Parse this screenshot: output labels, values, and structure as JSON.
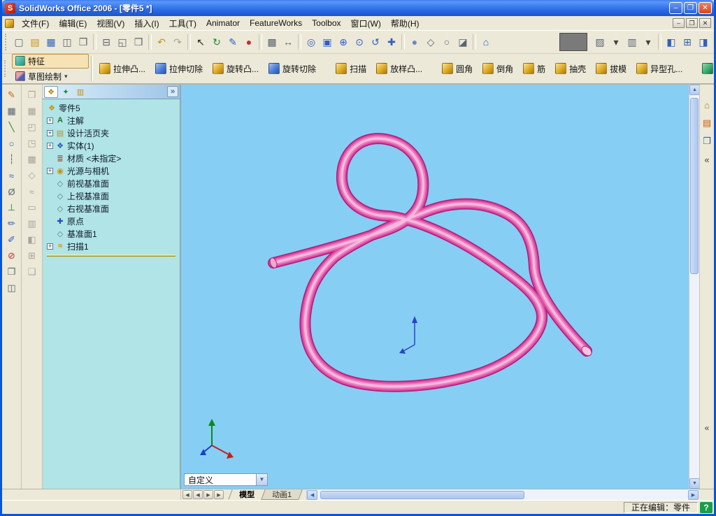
{
  "colors": {
    "titlebar_blue": "#2F6FE8",
    "toolbar_bg": "#ECE9D8",
    "tree_panel_cyan": "#B0E4E6",
    "viewport_blue": "#86CEF4",
    "knot_dark": "#B21E7C",
    "knot_main": "#DD4FA4",
    "knot_light": "#F7B9DE",
    "rollback_yellow": "#E8D020",
    "help_green": "#18A048",
    "active_tab_tan": "#F6E2B4"
  },
  "window": {
    "title": "SolidWorks Office 2006 - [零件5 *]",
    "minimize_glyph": "–",
    "restore_glyph": "❐",
    "close_glyph": "✕"
  },
  "menu": {
    "items": [
      {
        "label": "文件(F)",
        "name": "menu-file"
      },
      {
        "label": "编辑(E)",
        "name": "menu-edit"
      },
      {
        "label": "视图(V)",
        "name": "menu-view"
      },
      {
        "label": "插入(I)",
        "name": "menu-insert"
      },
      {
        "label": "工具(T)",
        "name": "menu-tools"
      },
      {
        "label": "Animator",
        "name": "menu-animator"
      },
      {
        "label": "FeatureWorks",
        "name": "menu-featureworks"
      },
      {
        "label": "Toolbox",
        "name": "menu-toolbox"
      },
      {
        "label": "窗口(W)",
        "name": "menu-window"
      },
      {
        "label": "帮助(H)",
        "name": "menu-help"
      }
    ],
    "mdi": {
      "minimize": "–",
      "restore": "❐",
      "close": "✕"
    }
  },
  "toolbar_main": {
    "icons": [
      {
        "name": "new-document-icon",
        "glyph": "▢",
        "cls": "c-gray",
        "inter": "true"
      },
      {
        "name": "open-document-icon",
        "glyph": "▤",
        "cls": "c-yellow",
        "inter": "true"
      },
      {
        "name": "save-icon",
        "glyph": "▦",
        "cls": "c-blue",
        "inter": "true"
      },
      {
        "name": "make-drawing-icon",
        "glyph": "◫",
        "cls": "c-gray",
        "inter": "true"
      },
      {
        "name": "make-assembly-icon",
        "glyph": "❒",
        "cls": "c-gray",
        "inter": "true"
      },
      {
        "name": "separator",
        "glyph": "",
        "cls": "sep",
        "inter": "false"
      },
      {
        "name": "print-icon",
        "glyph": "⊟",
        "cls": "c-gray",
        "inter": "true"
      },
      {
        "name": "print-preview-icon",
        "glyph": "◱",
        "cls": "c-gray",
        "inter": "true"
      },
      {
        "name": "copy-icon",
        "glyph": "❐",
        "cls": "c-gray",
        "inter": "true"
      },
      {
        "name": "separator",
        "glyph": "",
        "cls": "sep",
        "inter": "false"
      },
      {
        "name": "undo-icon",
        "glyph": "↶",
        "cls": "c-yellow",
        "inter": "true"
      },
      {
        "name": "redo-icon",
        "glyph": "↷",
        "cls": "c-dis",
        "inter": "true"
      },
      {
        "name": "separator",
        "glyph": "",
        "cls": "sep",
        "inter": "false"
      },
      {
        "name": "select-arrow-icon",
        "glyph": "↖",
        "cls": "c-black",
        "inter": "true"
      },
      {
        "name": "rebuild-icon",
        "glyph": "↻",
        "cls": "c-green",
        "inter": "true"
      },
      {
        "name": "sketch-icon",
        "glyph": "✎",
        "cls": "c-blue",
        "inter": "true"
      },
      {
        "name": "edit-color-icon",
        "glyph": "●",
        "cls": "c-red",
        "inter": "true"
      },
      {
        "name": "separator",
        "glyph": "",
        "cls": "sep",
        "inter": "false"
      },
      {
        "name": "display-grid-icon",
        "glyph": "▩",
        "cls": "c-gray",
        "inter": "true"
      },
      {
        "name": "dimension-icon",
        "glyph": "↔",
        "cls": "c-gray",
        "inter": "true"
      },
      {
        "name": "separator",
        "glyph": "",
        "cls": "sep",
        "inter": "false"
      },
      {
        "name": "zoom-fit-icon",
        "glyph": "◎",
        "cls": "c-blue",
        "inter": "true"
      },
      {
        "name": "zoom-area-icon",
        "glyph": "▣",
        "cls": "c-blue",
        "inter": "true"
      },
      {
        "name": "zoom-in-out-icon",
        "glyph": "⊕",
        "cls": "c-blue",
        "inter": "true"
      },
      {
        "name": "zoom-selected-icon",
        "glyph": "⊙",
        "cls": "c-blue",
        "inter": "true"
      },
      {
        "name": "rotate-view-icon",
        "glyph": "↺",
        "cls": "c-blue",
        "inter": "true"
      },
      {
        "name": "pan-icon",
        "glyph": "✚",
        "cls": "c-blue",
        "inter": "true"
      },
      {
        "name": "separator",
        "glyph": "",
        "cls": "sep",
        "inter": "false"
      },
      {
        "name": "shaded-view-icon",
        "glyph": "●",
        "cls": "c-shaded",
        "inter": "true"
      },
      {
        "name": "hidden-lines-icon",
        "glyph": "◇",
        "cls": "c-gray",
        "inter": "true"
      },
      {
        "name": "wireframe-icon",
        "glyph": "○",
        "cls": "c-gray",
        "inter": "true"
      },
      {
        "name": "section-view-icon",
        "glyph": "◪",
        "cls": "c-gray",
        "inter": "true"
      },
      {
        "name": "separator",
        "glyph": "",
        "cls": "sep",
        "inter": "false"
      },
      {
        "name": "view-orientation-icon",
        "glyph": "⌂",
        "cls": "c-blue",
        "inter": "true"
      }
    ],
    "right_icons": [
      {
        "name": "toolbox-panel-icon",
        "glyph": "▨",
        "cls": "c-gray",
        "inter": "true"
      },
      {
        "name": "dropdown-arrow-icon",
        "glyph": "▾",
        "cls": "c-dark",
        "inter": "true"
      },
      {
        "name": "options-icon",
        "glyph": "▥",
        "cls": "c-gray",
        "inter": "true"
      },
      {
        "name": "dropdown-arrow-icon",
        "glyph": "▾",
        "cls": "c-dark",
        "inter": "true"
      },
      {
        "name": "separator",
        "glyph": "",
        "cls": "sep",
        "inter": "false"
      },
      {
        "name": "pane-left-icon",
        "glyph": "◧",
        "cls": "c-blue",
        "inter": "true"
      },
      {
        "name": "pane-split-icon",
        "glyph": "⊞",
        "cls": "c-blue",
        "inter": "true"
      },
      {
        "name": "pane-right-icon",
        "glyph": "◨",
        "cls": "c-blue",
        "inter": "true"
      }
    ]
  },
  "command_manager": {
    "tabs": [
      {
        "label": "特征",
        "name": "tab-features",
        "icon": "features-tab-icon",
        "iconcls": "fi-teal",
        "cls": "act",
        "arrow": ""
      },
      {
        "label": "草图绘制",
        "name": "tab-sketch",
        "icon": "sketch-tab-icon",
        "iconcls": "fi-sketch",
        "cls": "",
        "arrow": "▾"
      }
    ],
    "buttons": [
      {
        "label": "拉伸凸...",
        "name": "extrude-boss-button",
        "icon": "extrude-boss-icon",
        "cls": "fi-gold",
        "btncls": ""
      },
      {
        "label": "拉伸切除",
        "name": "extruded-cut-button",
        "icon": "extruded-cut-icon",
        "cls": "fi-blue",
        "btncls": ""
      },
      {
        "label": "旋转凸...",
        "name": "revolve-boss-button",
        "icon": "revolve-boss-icon",
        "cls": "fi-gold",
        "btncls": ""
      },
      {
        "label": "旋转切除",
        "name": "revolved-cut-button",
        "icon": "revolved-cut-icon",
        "cls": "fi-blue",
        "btncls": ""
      },
      {
        "label": "扫描",
        "name": "sweep-button",
        "icon": "sweep-icon",
        "cls": "fi-gold",
        "btncls": "gapL"
      },
      {
        "label": "放样凸...",
        "name": "loft-button",
        "icon": "loft-icon",
        "cls": "fi-gold",
        "btncls": ""
      },
      {
        "label": "圆角",
        "name": "fillet-button",
        "icon": "fillet-icon",
        "cls": "fi-gold",
        "btncls": "gapL"
      },
      {
        "label": "倒角",
        "name": "chamfer-button",
        "icon": "chamfer-icon",
        "cls": "fi-gold",
        "btncls": ""
      },
      {
        "label": "筋",
        "name": "rib-button",
        "icon": "rib-icon",
        "cls": "fi-gold",
        "btncls": ""
      },
      {
        "label": "抽壳",
        "name": "shell-button",
        "icon": "shell-icon",
        "cls": "fi-gold",
        "btncls": ""
      },
      {
        "label": "拔模",
        "name": "draft-button",
        "icon": "draft-icon",
        "cls": "fi-gold",
        "btncls": ""
      },
      {
        "label": "异型孔...",
        "name": "hole-wizard-button",
        "icon": "hole-wizard-icon",
        "cls": "fi-gold",
        "btncls": ""
      },
      {
        "label": "线性阵列",
        "name": "linear-pattern-button",
        "icon": "linear-pattern-icon",
        "cls": "fi-green",
        "btncls": "gapL"
      }
    ]
  },
  "left_toolbar_a": {
    "icons": [
      {
        "name": "sketch-pencil-icon",
        "glyph": "✎",
        "cls": "c-orange"
      },
      {
        "name": "grid-system-icon",
        "glyph": "▦",
        "cls": "c-gray"
      },
      {
        "name": "line-tool-icon",
        "glyph": "╲",
        "cls": "c-green"
      },
      {
        "name": "circle-tool-icon",
        "glyph": "○",
        "cls": "c-blue"
      },
      {
        "name": "centerline-tool-icon",
        "glyph": "┆",
        "cls": "c-gray"
      },
      {
        "name": "spline-tool-icon",
        "glyph": "≈",
        "cls": "c-blue"
      },
      {
        "name": "smart-dimension-icon",
        "glyph": "Ø",
        "cls": "c-gray"
      },
      {
        "name": "add-relation-icon",
        "glyph": "⊥",
        "cls": "c-green"
      },
      {
        "name": "sketch-edit-icon",
        "glyph": "✏",
        "cls": "c-blue"
      },
      {
        "name": "sketch-exit-icon",
        "glyph": "✐",
        "cls": "c-blue"
      },
      {
        "name": "delete-relation-icon",
        "glyph": "⊘",
        "cls": "c-red"
      },
      {
        "name": "convert-entities-icon",
        "glyph": "❒",
        "cls": "c-gray"
      },
      {
        "name": "mirror-entities-icon",
        "glyph": "◫",
        "cls": "c-gray"
      }
    ]
  },
  "left_toolbar_b": {
    "icons": [
      {
        "name": "reference-geometry-icon",
        "glyph": "❒",
        "cls": "c-dis"
      },
      {
        "name": "features-cube-icon",
        "glyph": "▦",
        "cls": "c-dis"
      },
      {
        "name": "fillet-gray-icon",
        "glyph": "◰",
        "cls": "c-dis"
      },
      {
        "name": "pattern-gray-icon",
        "glyph": "◳",
        "cls": "c-dis"
      },
      {
        "name": "surface-icon",
        "glyph": "▩",
        "cls": "c-dis"
      },
      {
        "name": "curve-icon",
        "glyph": "◇",
        "cls": "c-dis"
      },
      {
        "name": "sheet-metal-icon",
        "glyph": "≈",
        "cls": "c-dis"
      },
      {
        "name": "weldment-icon",
        "glyph": "▭",
        "cls": "c-dis"
      },
      {
        "name": "mold-tools-icon",
        "glyph": "▥",
        "cls": "c-dis"
      },
      {
        "name": "evaluate-icon",
        "glyph": "◧",
        "cls": "c-dis"
      },
      {
        "name": "dimxpert-icon",
        "glyph": "⊞",
        "cls": "c-dis"
      },
      {
        "name": "render-tools-icon",
        "glyph": "❏",
        "cls": "c-dis"
      }
    ]
  },
  "feature_tree": {
    "header_tabs": [
      {
        "icon": "featuremanager-tab-icon",
        "glyph": "❖",
        "cls": "act ic-gold2"
      },
      {
        "icon": "propertymanager-tab-icon",
        "glyph": "✦",
        "cls": "ic-green"
      },
      {
        "icon": "configurationmanager-tab-icon",
        "glyph": "▥",
        "cls": "ic-gold"
      }
    ],
    "collapse_glyph": "»",
    "root": {
      "label": "零件5",
      "icon": "part-icon",
      "glyph": "❖"
    },
    "items": [
      {
        "label": "注解",
        "icon": "annotations-icon",
        "glyph": "A",
        "cls": "ic-ann",
        "exp": "+",
        "expcls": "show"
      },
      {
        "label": "设计活页夹",
        "icon": "design-binder-icon",
        "glyph": "▤",
        "cls": "ic-gold",
        "exp": "+",
        "expcls": "show"
      },
      {
        "label": "实体(1)",
        "icon": "solid-bodies-icon",
        "glyph": "❖",
        "cls": "ic-blue",
        "exp": "+",
        "expcls": "show"
      },
      {
        "label": "材质 <未指定>",
        "icon": "material-icon",
        "glyph": "≣",
        "cls": "ic-mat",
        "exp": "",
        "expcls": "hide"
      },
      {
        "label": "光源与相机",
        "icon": "lights-cameras-icon",
        "glyph": "◉",
        "cls": "ic-gold",
        "exp": "+",
        "expcls": "show"
      },
      {
        "label": "前视基准面",
        "icon": "plane-icon",
        "glyph": "◇",
        "cls": "ic-plane",
        "exp": "",
        "expcls": "hide"
      },
      {
        "label": "上视基准面",
        "icon": "plane-icon",
        "glyph": "◇",
        "cls": "ic-plane",
        "exp": "",
        "expcls": "hide"
      },
      {
        "label": "右视基准面",
        "icon": "plane-icon",
        "glyph": "◇",
        "cls": "ic-plane",
        "exp": "",
        "expcls": "hide"
      },
      {
        "label": "原点",
        "icon": "origin-icon",
        "glyph": "✚",
        "cls": "ic-origin",
        "exp": "",
        "expcls": "hide"
      },
      {
        "label": "基准面1",
        "icon": "plane-icon",
        "glyph": "◇",
        "cls": "ic-plane",
        "exp": "",
        "expcls": "hide"
      },
      {
        "label": "扫描1",
        "icon": "sweep-feature-icon",
        "glyph": "≈",
        "cls": "ic-gold",
        "exp": "+",
        "expcls": "show"
      }
    ]
  },
  "viewport": {
    "view_combo_value": "自定义",
    "combo_arrow": "▼"
  },
  "scrollbars": {
    "up": "▲",
    "down": "▼",
    "left": "◀",
    "right": "▶"
  },
  "task_pane": {
    "icons": [
      {
        "name": "home-resources-icon",
        "glyph": "⌂",
        "cls": "c-gold"
      },
      {
        "name": "design-library-icon",
        "glyph": "▤",
        "cls": "c-orange"
      },
      {
        "name": "file-explorer-icon",
        "glyph": "❒",
        "cls": "c-blue"
      },
      {
        "name": "collapse-chevron-icon",
        "glyph": "«",
        "cls": "c-dark"
      }
    ],
    "lower_chevron": "«"
  },
  "doc_tabs": {
    "nav": [
      {
        "glyph": "◀",
        "name": "first-tab-button"
      },
      {
        "glyph": "◀",
        "name": "prev-tab-button"
      },
      {
        "glyph": "▶",
        "name": "next-tab-button"
      },
      {
        "glyph": "▶",
        "name": "last-tab-button"
      }
    ],
    "items": [
      {
        "label": "模型",
        "name": "tab-model",
        "cls": "active"
      },
      {
        "label": "动画1",
        "name": "tab-motion-study",
        "cls": ""
      }
    ]
  },
  "status_bar": {
    "editing_label": "正在编辑：零件",
    "help_glyph": "?"
  }
}
